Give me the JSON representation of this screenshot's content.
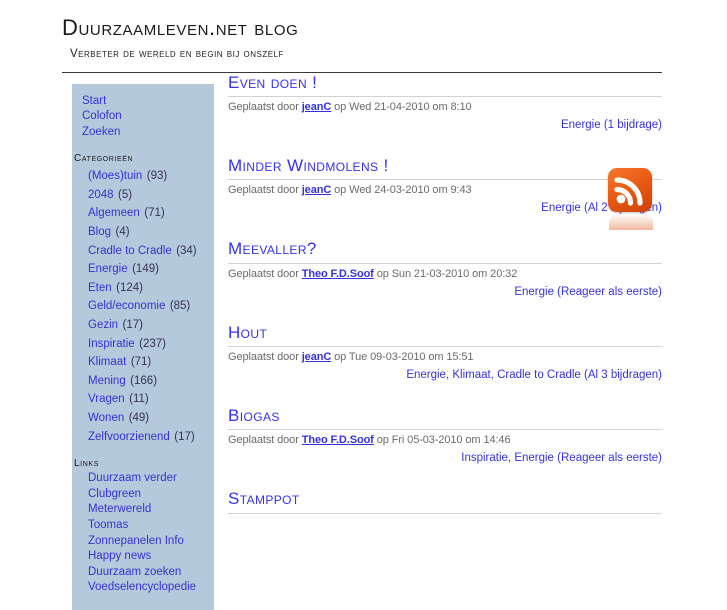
{
  "site": {
    "title": "Duurzaamleven.net blog",
    "tagline": "Verbeter de wereld en begin bij onszelf"
  },
  "colors": {
    "sidebar_background": "#b5c9dd",
    "link": "#3333cc",
    "post_title": "#3333ee",
    "meta_text": "#6b6b6b",
    "rss_orange": "#ea5c14",
    "rule": "#d2d2d2"
  },
  "sidebar": {
    "nav": [
      {
        "label": "Start"
      },
      {
        "label": "Colofon"
      },
      {
        "label": "Zoeken"
      }
    ],
    "categories_heading": "Categorieën",
    "categories": [
      {
        "label": "(Moes)tuin",
        "count": "(93)"
      },
      {
        "label": "2048",
        "count": "(5)"
      },
      {
        "label": "Algemeen",
        "count": "(71)"
      },
      {
        "label": "Blog",
        "count": "(4)"
      },
      {
        "label": "Cradle to Cradle",
        "count": "(34)"
      },
      {
        "label": "Energie",
        "count": "(149)"
      },
      {
        "label": "Eten",
        "count": "(124)"
      },
      {
        "label": "Geld/economie",
        "count": "(85)"
      },
      {
        "label": "Gezin",
        "count": "(17)"
      },
      {
        "label": "Inspiratie",
        "count": "(237)"
      },
      {
        "label": "Klimaat",
        "count": "(71)"
      },
      {
        "label": "Mening",
        "count": "(166)"
      },
      {
        "label": "Vragen",
        "count": "(11)"
      },
      {
        "label": "Wonen",
        "count": "(49)"
      },
      {
        "label": "Zelfvoorzienend",
        "count": "(17)"
      }
    ],
    "links_heading": "Links",
    "links": [
      {
        "label": "Duurzaam verder"
      },
      {
        "label": "Clubgreen"
      },
      {
        "label": "Meterwereld"
      },
      {
        "label": "Toomas"
      },
      {
        "label": "Zonnepanelen Info"
      },
      {
        "label": "Happy news"
      },
      {
        "label": "Duurzaam zoeken"
      },
      {
        "label": "Voedselencyclopedie"
      }
    ]
  },
  "rss": {
    "icon": "rss-feed-icon",
    "label": "RSS feed"
  },
  "posts": [
    {
      "title": "Even doen !",
      "meta_prefix": "Geplaatst door ",
      "author": "jeanC",
      "meta_suffix": " op Wed 21-04-2010 om 8:10",
      "categories": "Energie",
      "comments": "(1 bijdrage)"
    },
    {
      "title": "Minder Windmolens !",
      "meta_prefix": "Geplaatst door ",
      "author": "jeanC",
      "meta_suffix": " op Wed 24-03-2010 om 9:43",
      "categories": "Energie",
      "comments": "(Al 2 bijdragen)"
    },
    {
      "title": "Meevaller?",
      "meta_prefix": "Geplaatst door ",
      "author": "Theo F.D.Soof",
      "meta_suffix": " op Sun 21-03-2010 om 20:32",
      "categories": "Energie",
      "comments": "(Reageer als eerste)"
    },
    {
      "title": "Hout",
      "meta_prefix": "Geplaatst door ",
      "author": "jeanC",
      "meta_suffix": " op Tue 09-03-2010 om 15:51",
      "categories": "Energie, Klimaat, Cradle to Cradle",
      "comments": "(Al 3 bijdragen)"
    },
    {
      "title": "Biogas",
      "meta_prefix": "Geplaatst door ",
      "author": "Theo F.D.Soof",
      "meta_suffix": " op Fri 05-03-2010 om 14:46",
      "categories": "Inspiratie, Energie",
      "comments": "(Reageer als eerste)"
    },
    {
      "title": "Stamppot",
      "meta_prefix": "",
      "author": "",
      "meta_suffix": "",
      "categories": "",
      "comments": ""
    }
  ]
}
